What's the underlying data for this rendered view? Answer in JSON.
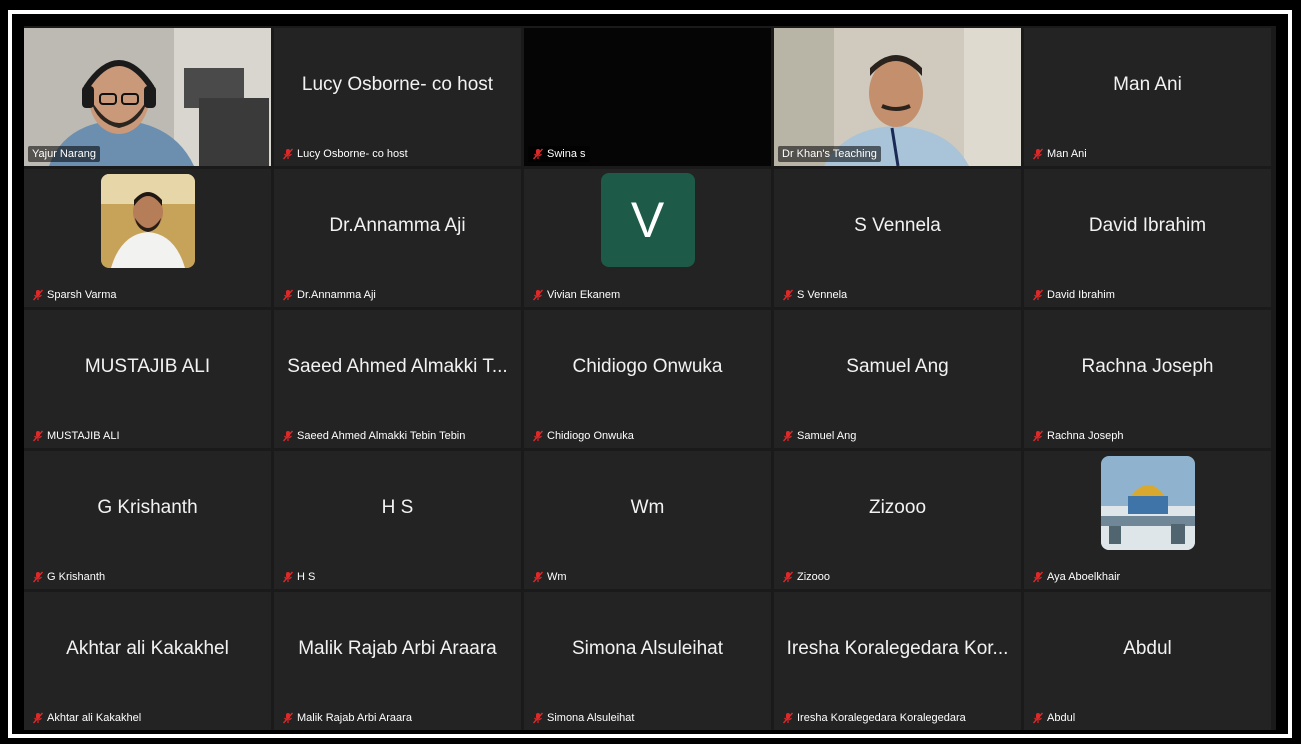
{
  "participants": [
    {
      "name": "Yajur Narang",
      "display": "",
      "type": "video-man-headphones"
    },
    {
      "name": "Lucy Osborne- co host",
      "display": "Lucy Osborne- co host",
      "type": "name"
    },
    {
      "name": "Swina s",
      "display": "",
      "type": "black"
    },
    {
      "name": "Dr Khan's Teaching",
      "display": "",
      "type": "video-man-office",
      "active": true
    },
    {
      "name": "Man Ani",
      "display": "Man Ani",
      "type": "name"
    },
    {
      "name": "Sparsh Varma",
      "display": "",
      "type": "photo-avatar"
    },
    {
      "name": "Dr.Annamma Aji",
      "display": "Dr.Annamma Aji",
      "type": "name"
    },
    {
      "name": "Vivian Ekanem",
      "display": "",
      "type": "letter-avatar",
      "letter": "V"
    },
    {
      "name": "S Vennela",
      "display": "S Vennela",
      "type": "name"
    },
    {
      "name": "David Ibrahim",
      "display": "David Ibrahim",
      "type": "name"
    },
    {
      "name": "MUSTAJIB ALI",
      "display": "MUSTAJIB ALI",
      "type": "name"
    },
    {
      "name": "Saeed Ahmed Almakki Tebin Tebin",
      "display": "Saeed Ahmed Almakki T...",
      "type": "name"
    },
    {
      "name": "Chidiogo Onwuka",
      "display": "Chidiogo Onwuka",
      "type": "name"
    },
    {
      "name": "Samuel Ang",
      "display": "Samuel Ang",
      "type": "name"
    },
    {
      "name": "Rachna Joseph",
      "display": "Rachna Joseph",
      "type": "name"
    },
    {
      "name": "G Krishanth",
      "display": "G Krishanth",
      "type": "name"
    },
    {
      "name": "H S",
      "display": "H S",
      "type": "name"
    },
    {
      "name": "Wm",
      "display": "Wm",
      "type": "name"
    },
    {
      "name": "Zizooo",
      "display": "Zizooo",
      "type": "name"
    },
    {
      "name": "Aya Aboelkhair",
      "display": "",
      "type": "photo-dome"
    },
    {
      "name": "Akhtar ali Kakakhel",
      "display": "Akhtar ali Kakakhel",
      "type": "name"
    },
    {
      "name": "Malik Rajab Arbi Araara",
      "display": "Malik Rajab Arbi Araara",
      "type": "name"
    },
    {
      "name": "Simona Alsuleihat",
      "display": "Simona Alsuleihat",
      "type": "name"
    },
    {
      "name": "Iresha Koralegedara Koralegedara",
      "display": "Iresha Koralegedara Kor...",
      "type": "name"
    },
    {
      "name": "Abdul",
      "display": "Abdul",
      "type": "name"
    }
  ],
  "colors": {
    "muted_mic": "#e02828",
    "active_speaker": "#2ecc40",
    "letter_avatar_bg": "#1d5a48"
  },
  "icons": {
    "muted": "mic-muted-icon"
  }
}
